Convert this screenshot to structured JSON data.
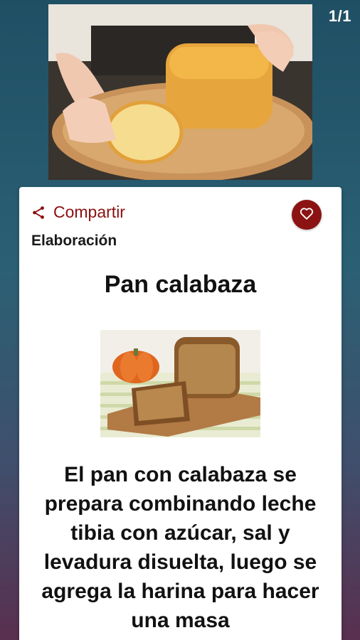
{
  "pager": {
    "text": "1/1"
  },
  "card": {
    "share_label": "Compartir",
    "share_icon": "share-icon",
    "favorite_icon": "heart-icon",
    "section_label": "Elaboración",
    "title": "Pan calabaza",
    "description": "El pan con calabaza se prepara combinando leche tibia con azúcar, sal y levadura disuelta, luego se agrega la harina para hacer una masa"
  },
  "colors": {
    "accent": "#8b1313",
    "card_bg": "#ffffff",
    "background_top": "#1f4f64",
    "background_bottom": "#5a2f4f"
  }
}
